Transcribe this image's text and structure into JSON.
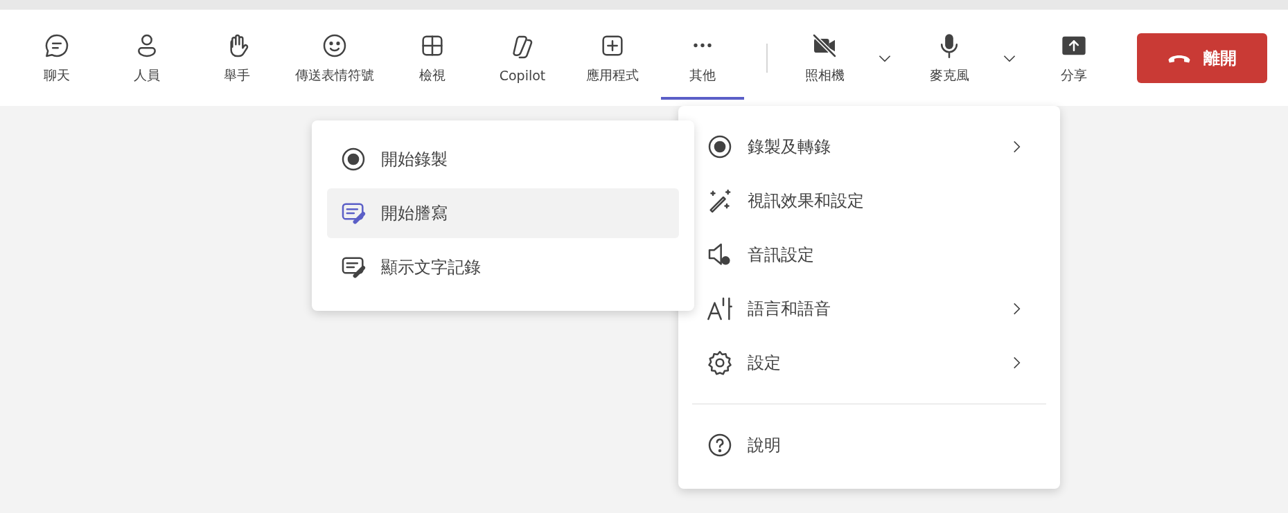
{
  "toolbar": {
    "items": [
      {
        "label": "聊天",
        "kind": "chat",
        "selected": false,
        "dropdown": false
      },
      {
        "label": "人員",
        "kind": "people",
        "selected": false,
        "dropdown": false
      },
      {
        "label": "舉手",
        "kind": "hand",
        "selected": false,
        "dropdown": false
      },
      {
        "label": "傳送表情符號",
        "kind": "emoji",
        "selected": false,
        "dropdown": false
      },
      {
        "label": "檢視",
        "kind": "view",
        "selected": false,
        "dropdown": false
      },
      {
        "label": "Copilot",
        "kind": "copilot",
        "selected": false,
        "dropdown": false
      },
      {
        "label": "應用程式",
        "kind": "apps",
        "selected": false,
        "dropdown": false
      },
      {
        "label": "其他",
        "kind": "more",
        "selected": true,
        "dropdown": false
      },
      {
        "label": "照相機",
        "kind": "camera",
        "selected": false,
        "dropdown": true
      },
      {
        "label": "麥克風",
        "kind": "mic",
        "selected": false,
        "dropdown": true
      },
      {
        "label": "分享",
        "kind": "share",
        "selected": false,
        "dropdown": false
      }
    ],
    "leave_button": {
      "label": "離開"
    }
  },
  "more_menu": {
    "items": [
      {
        "label": "錄製及轉錄",
        "kind": "record",
        "submenu": true
      },
      {
        "label": "視訊效果和設定",
        "kind": "effects",
        "submenu": false
      },
      {
        "label": "音訊設定",
        "kind": "audio",
        "submenu": false
      },
      {
        "label": "語言和語音",
        "kind": "language",
        "submenu": true
      },
      {
        "label": "設定",
        "kind": "settings",
        "submenu": true
      }
    ],
    "footer_items": [
      {
        "label": "說明",
        "kind": "help",
        "submenu": false
      }
    ]
  },
  "recording_submenu": {
    "items": [
      {
        "label": "開始錄製",
        "kind": "record",
        "selected": false
      },
      {
        "label": "開始謄寫",
        "kind": "transcribe",
        "selected": true
      },
      {
        "label": "顯示文字記錄",
        "kind": "transcribe",
        "selected": false
      }
    ]
  }
}
